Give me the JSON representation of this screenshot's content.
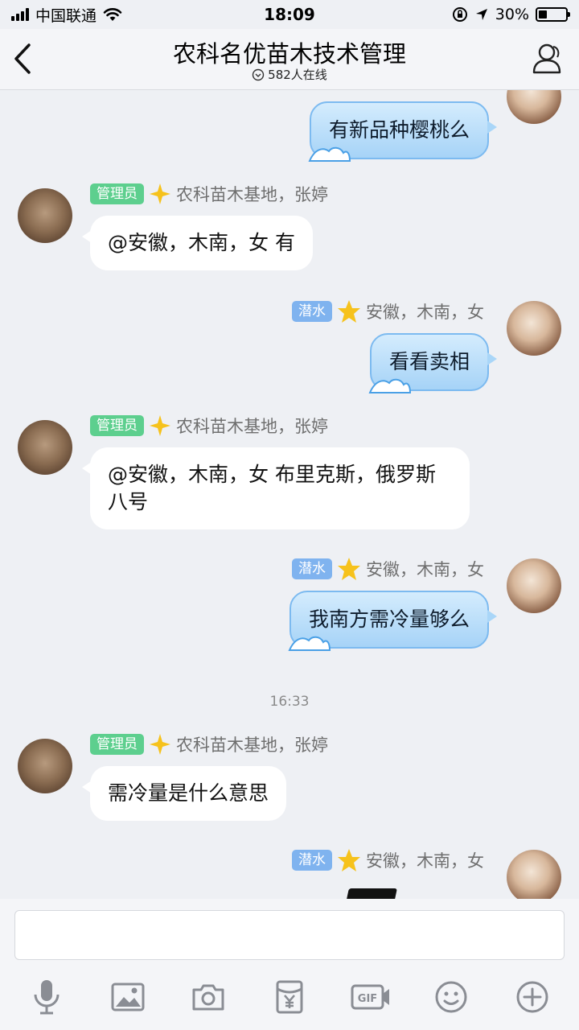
{
  "status_bar": {
    "carrier": "中国联通",
    "time": "18:09",
    "battery_percent": "30%",
    "battery_level": 0.3,
    "icons": [
      "signal-icon",
      "wifi-icon",
      "orientation-lock-icon",
      "location-arrow-icon",
      "battery-icon"
    ]
  },
  "header": {
    "title": "农科名优苗木技术管理",
    "online_count": "582人在线",
    "icons": [
      "back-icon",
      "online-dot-icon",
      "group-profile-icon"
    ]
  },
  "messages": [
    {
      "side": "right",
      "badge": "",
      "sender": "",
      "text": "有新品种樱桃么"
    },
    {
      "side": "left",
      "badge": "管理员",
      "sender": "农科苗木基地，张婷",
      "text": "@安徽，木南，女 有"
    },
    {
      "side": "right",
      "badge": "潜水",
      "sender": "安徽，木南，女",
      "text": "看看卖相"
    },
    {
      "side": "left",
      "badge": "管理员",
      "sender": "农科苗木基地，张婷",
      "text": "@安徽，木南，女 布里克斯，俄罗斯八号"
    },
    {
      "side": "right",
      "badge": "潜水",
      "sender": "安徽，木南，女",
      "text": "我南方需冷量够么"
    },
    {
      "side": "left",
      "badge": "管理员",
      "sender": "农科苗木基地，张婷",
      "text": "需冷量是什么意思"
    },
    {
      "side": "right",
      "badge": "潜水",
      "sender": "安徽，木南，女",
      "text": ""
    }
  ],
  "timestamp": "16:33",
  "input": {
    "value": "",
    "placeholder": ""
  },
  "toolbar": [
    {
      "name": "voice-button",
      "icon": "microphone-icon"
    },
    {
      "name": "image-button",
      "icon": "image-icon"
    },
    {
      "name": "camera-button",
      "icon": "camera-icon"
    },
    {
      "name": "red-packet-button",
      "icon": "red-packet-icon"
    },
    {
      "name": "gif-button",
      "icon": "gif-icon",
      "label": "GIF"
    },
    {
      "name": "emoji-button",
      "icon": "emoji-icon"
    },
    {
      "name": "more-button",
      "icon": "plus-icon"
    }
  ],
  "colors": {
    "background": "#eef0f4",
    "admin_badge": "#5dcf8e",
    "diver_badge": "#7fb3ef",
    "blue_bubble": "#a6d3f7",
    "star": "#f6c21c"
  }
}
